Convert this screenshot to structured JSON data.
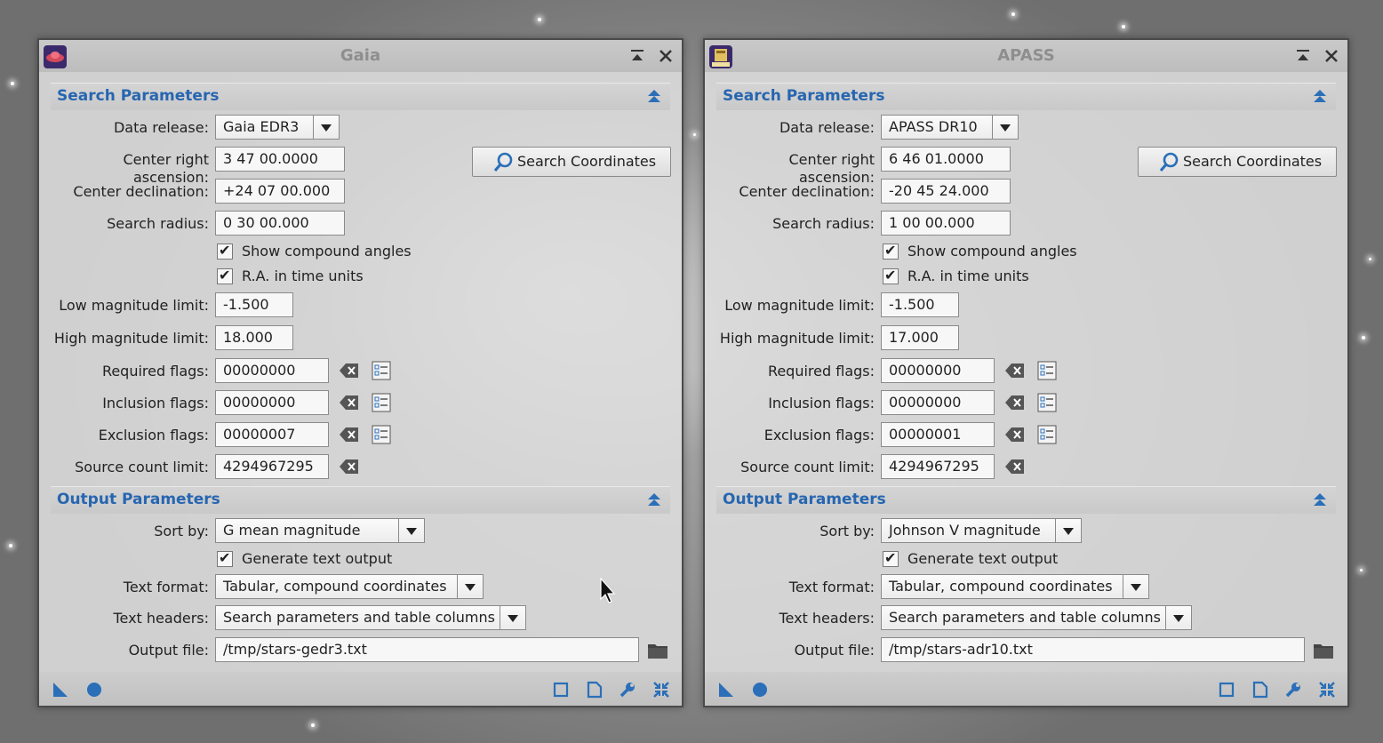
{
  "windows": [
    {
      "id": "gaia",
      "title": "Gaia",
      "search": {
        "section_title": "Search Parameters",
        "data_release_label": "Data release:",
        "data_release_value": "Gaia EDR3",
        "ra_label": "Center right ascension:",
        "ra_value": "3 47 00.0000",
        "dec_label": "Center declination:",
        "dec_value": "+24 07 00.000",
        "radius_label": "Search radius:",
        "radius_value": "0 30 00.000",
        "show_compound_angles": "Show compound angles",
        "ra_time_units": "R.A. in time units",
        "low_mag_label": "Low magnitude limit:",
        "low_mag_value": "-1.500",
        "high_mag_label": "High magnitude limit:",
        "high_mag_value": "18.000",
        "required_flags_label": "Required flags:",
        "required_flags_value": "00000000",
        "inclusion_flags_label": "Inclusion flags:",
        "inclusion_flags_value": "00000000",
        "exclusion_flags_label": "Exclusion flags:",
        "exclusion_flags_value": "00000007",
        "source_count_label": "Source count limit:",
        "source_count_value": "4294967295",
        "search_button": "Search Coordinates"
      },
      "output": {
        "section_title": "Output Parameters",
        "sort_label": "Sort by:",
        "sort_value": "G mean magnitude",
        "generate_text": "Generate text output",
        "text_format_label": "Text format:",
        "text_format_value": "Tabular, compound coordinates",
        "text_headers_label": "Text headers:",
        "text_headers_value": "Search parameters and table columns",
        "output_file_label": "Output file:",
        "output_file_value": "/tmp/stars-gedr3.txt"
      }
    },
    {
      "id": "apass",
      "title": "APASS",
      "search": {
        "section_title": "Search Parameters",
        "data_release_label": "Data release:",
        "data_release_value": "APASS DR10",
        "ra_label": "Center right ascension:",
        "ra_value": "6 46 01.0000",
        "dec_label": "Center declination:",
        "dec_value": "-20 45 24.000",
        "radius_label": "Search radius:",
        "radius_value": "1 00 00.000",
        "show_compound_angles": "Show compound angles",
        "ra_time_units": "R.A. in time units",
        "low_mag_label": "Low magnitude limit:",
        "low_mag_value": "-1.500",
        "high_mag_label": "High magnitude limit:",
        "high_mag_value": "17.000",
        "required_flags_label": "Required flags:",
        "required_flags_value": "00000000",
        "inclusion_flags_label": "Inclusion flags:",
        "inclusion_flags_value": "00000000",
        "exclusion_flags_label": "Exclusion flags:",
        "exclusion_flags_value": "00000001",
        "source_count_label": "Source count limit:",
        "source_count_value": "4294967295",
        "search_button": "Search Coordinates"
      },
      "output": {
        "section_title": "Output Parameters",
        "sort_label": "Sort by:",
        "sort_value": "Johnson V magnitude",
        "generate_text": "Generate text output",
        "text_format_label": "Text format:",
        "text_format_value": "Tabular, compound coordinates",
        "text_headers_label": "Text headers:",
        "text_headers_value": "Search parameters and table columns",
        "output_file_label": "Output file:",
        "output_file_value": "/tmp/stars-adr10.txt"
      }
    }
  ],
  "icons": {
    "titlebar": [
      "shade-icon",
      "close-icon"
    ],
    "bottombar_left": [
      "new-instance-icon",
      "apply-global-icon"
    ],
    "bottombar_right": [
      "preview-icon",
      "export-icon",
      "settings-icon",
      "reset-icon"
    ],
    "section": "collapse-icon",
    "search": "magnifier-icon",
    "flags": [
      "clear-icon",
      "edit-flags-icon"
    ],
    "output_file": "folder-icon"
  },
  "colors": {
    "section_title": "#2766b0",
    "icon_blue": "#2a6fb8",
    "window_title": "#8e8e8e"
  }
}
